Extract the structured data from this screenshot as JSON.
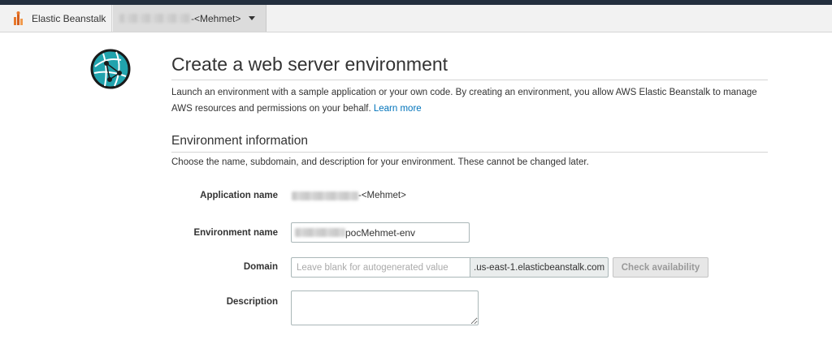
{
  "nav": {
    "service_label": "Elastic Beanstalk",
    "service_icon": "beanstalk-icon",
    "app_label": "-<Mehmet>",
    "caret_icon": "caret-down-icon"
  },
  "page": {
    "logo_icon": "web-server-globe-icon",
    "title": "Create a web server environment",
    "intro_text": "Launch an environment with a sample application or your own code. By creating an environment, you allow AWS Elastic Beanstalk to manage AWS resources and permissions on your behalf.",
    "learn_more": "Learn more"
  },
  "env_info": {
    "heading": "Environment information",
    "description": "Choose the name, subdomain, and description for your environment. These cannot be changed later.",
    "app_name_label": "Application name",
    "app_name_value": "-<Mehmet>",
    "env_name_label": "Environment name",
    "env_name_value": "pocMehmet-env",
    "domain_label": "Domain",
    "domain_placeholder": "Leave blank for autogenerated value",
    "domain_suffix": ".us-east-1.elasticbeanstalk.com",
    "check_button": "Check availability",
    "description_label": "Description"
  },
  "colors": {
    "accent_link": "#0073bb",
    "top_strip": "#232f3e",
    "logo_teal": "#21a3ad",
    "beanstalk_orange": "#e8782a"
  }
}
